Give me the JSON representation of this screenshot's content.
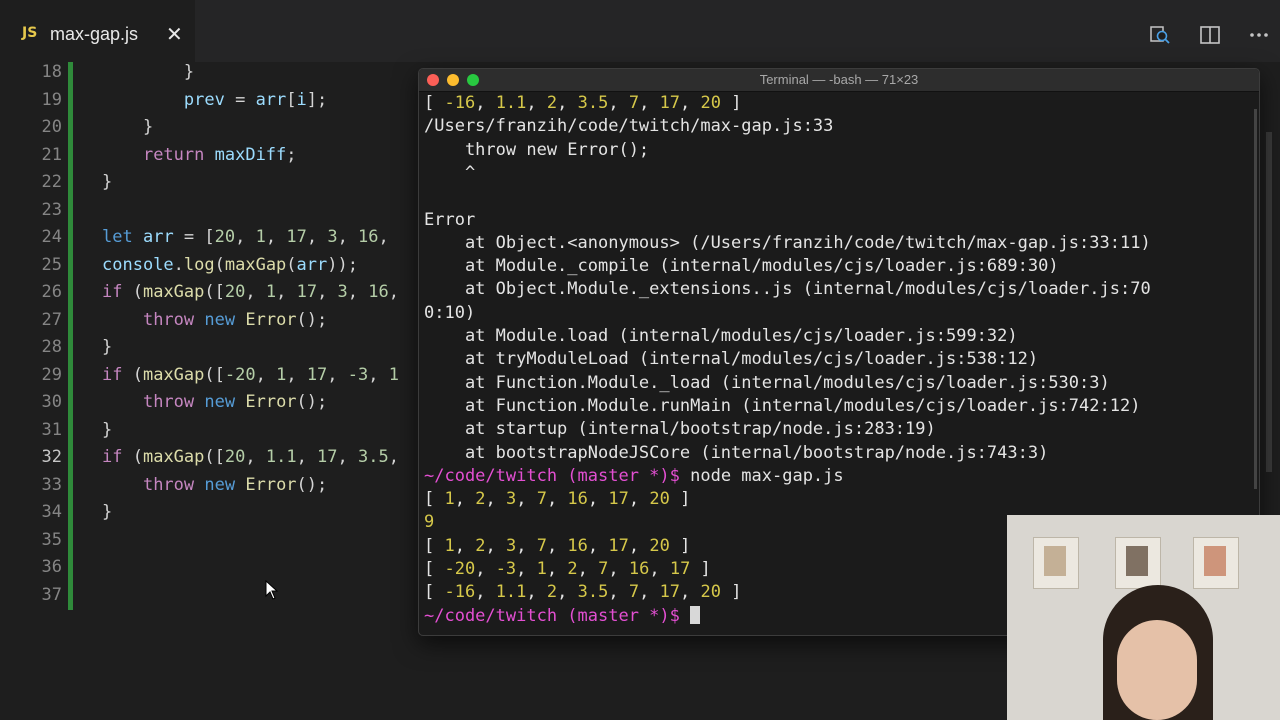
{
  "editor_tab": {
    "icon_label": "JS",
    "file_name": "max-gap.js",
    "close_glyph": "✕"
  },
  "toolbar": {
    "icons": [
      "search-in-files-icon",
      "split-editor-icon",
      "more-actions-icon"
    ]
  },
  "code_lines": [
    {
      "num": "18",
      "text": "        }"
    },
    {
      "num": "19",
      "text": "        prev = arr[i];"
    },
    {
      "num": "20",
      "text": "    }"
    },
    {
      "num": "21",
      "text": "    return maxDiff;"
    },
    {
      "num": "22",
      "text": "}"
    },
    {
      "num": "23",
      "text": ""
    },
    {
      "num": "24",
      "text": "let arr = [20, 1, 17, 3, 16,"
    },
    {
      "num": "25",
      "text": "console.log(maxGap(arr));"
    },
    {
      "num": "26",
      "text": "if (maxGap([20, 1, 17, 3, 16,"
    },
    {
      "num": "27",
      "text": "    throw new Error();"
    },
    {
      "num": "28",
      "text": "}"
    },
    {
      "num": "29",
      "text": "if (maxGap([-20, 1, 17, -3, 1"
    },
    {
      "num": "30",
      "text": "    throw new Error();"
    },
    {
      "num": "31",
      "text": "}"
    },
    {
      "num": "32",
      "text": "if (maxGap([20, 1.1, 17, 3.5,"
    },
    {
      "num": "33",
      "text": "    throw new Error();"
    },
    {
      "num": "34",
      "text": "}"
    },
    {
      "num": "35",
      "text": ""
    },
    {
      "num": "36",
      "text": ""
    },
    {
      "num": "37",
      "text": ""
    }
  ],
  "terminal": {
    "title": "Terminal — -bash — 71×23",
    "lines": [
      "[ -16, 1.1, 2, 3.5, 7, 17, 20 ]",
      "/Users/franzih/code/twitch/max-gap.js:33",
      "    throw new Error();",
      "    ^",
      "",
      "Error",
      "    at Object.<anonymous> (/Users/franzih/code/twitch/max-gap.js:33:11)",
      "    at Module._compile (internal/modules/cjs/loader.js:689:30)",
      "    at Object.Module._extensions..js (internal/modules/cjs/loader.js:70",
      "0:10)",
      "    at Module.load (internal/modules/cjs/loader.js:599:32)",
      "    at tryModuleLoad (internal/modules/cjs/loader.js:538:12)",
      "    at Function.Module._load (internal/modules/cjs/loader.js:530:3)",
      "    at Function.Module.runMain (internal/modules/cjs/loader.js:742:12)",
      "    at startup (internal/bootstrap/node.js:283:19)",
      "    at bootstrapNodeJSCore (internal/bootstrap/node.js:743:3)",
      "~/code/twitch (master *)$ node max-gap.js",
      "[ 1, 2, 3, 7, 16, 17, 20 ]",
      "9",
      "[ 1, 2, 3, 7, 16, 17, 20 ]",
      "[ -20, -3, 1, 2, 7, 16, 17 ]",
      "[ -16, 1.1, 2, 3.5, 7, 17, 20 ]",
      "~/code/twitch (master *)$ "
    ]
  },
  "colors": {
    "editor_bg": "#1e1e1e",
    "keyword": "#c586c0",
    "keyword_blue": "#569cd6",
    "function": "#dcdcaa",
    "variable": "#9cdcfe",
    "number": "#b5cea8",
    "terminal_number": "#d6c84a",
    "prompt": "#e34fd2",
    "modified_gutter": "#2f8a3a"
  }
}
